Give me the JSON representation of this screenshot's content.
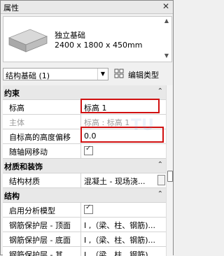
{
  "panel": {
    "title": "属性",
    "close_glyph": "✕"
  },
  "type_preview": {
    "family": "独立基础",
    "dimensions": "2400 x 1800 x 450mm"
  },
  "type_selector": {
    "value": "结构基础 (1)",
    "edit_type_label": "编辑类型"
  },
  "categories": {
    "constraints": "约束",
    "materials": "材质和装饰",
    "structure": "结构"
  },
  "rows": {
    "level": {
      "name": "标高",
      "value": "标高 1"
    },
    "host": {
      "name": "主体",
      "value": "标高 : 标高 1"
    },
    "offset": {
      "name": "自标高的高度偏移",
      "value": "0.0"
    },
    "move_with_grids": {
      "name": "随轴网移动",
      "checked": true
    },
    "structural_material": {
      "name": "结构材质",
      "value": "混凝土 - 现场浇..."
    },
    "analytical_model": {
      "name": "启用分析模型",
      "checked": true
    },
    "cover_top": {
      "name": "钢筋保护层 - 顶面",
      "value": "I ,（梁、柱、钢筋)..."
    },
    "cover_bottom": {
      "name": "钢筋保护层 - 底面",
      "value": "I ,（梁、柱、钢筋)..."
    },
    "cover_other": {
      "name": "钢筋保护层 - 其...",
      "value": "I ,（梁、柱、钢筋)..."
    }
  },
  "collapse_glyph": "⌃",
  "watermark": "TU",
  "colors": {
    "highlight": "#d11010",
    "category_bg": "#e8e8e8"
  }
}
